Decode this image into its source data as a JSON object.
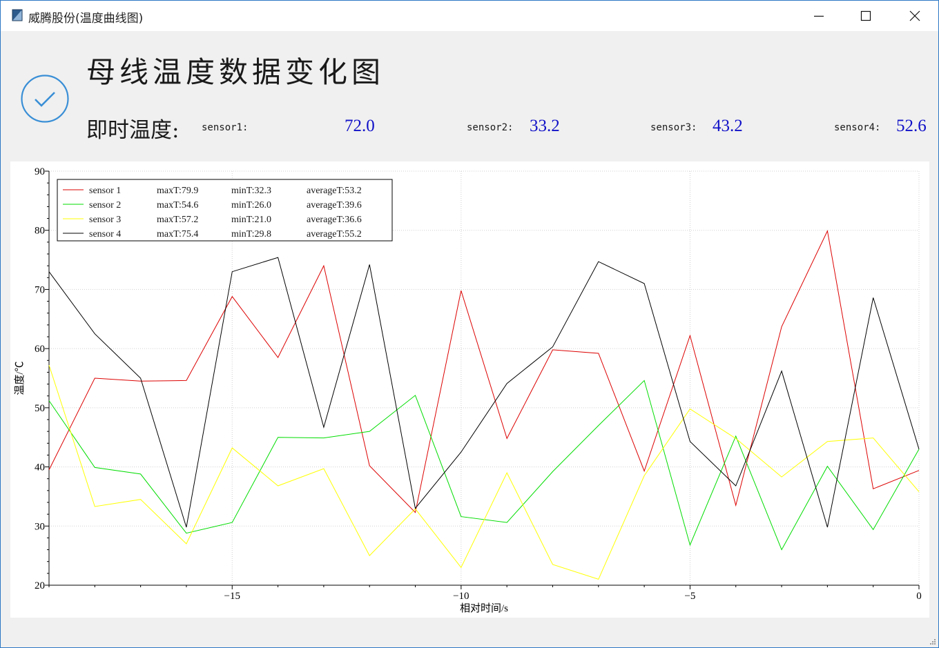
{
  "window": {
    "title": "威腾股份(温度曲线图)"
  },
  "header": {
    "title": "母线温度数据变化图",
    "live_label": "即时温度:",
    "sensors": [
      {
        "label": "sensor1:",
        "value": "72.0"
      },
      {
        "label": "sensor2:",
        "value": "33.2"
      },
      {
        "label": "sensor3:",
        "value": "43.2"
      },
      {
        "label": "sensor4:",
        "value": "52.6"
      }
    ],
    "icon": "check-circle-icon",
    "value_color": "#1010c8"
  },
  "chart_data": {
    "type": "line",
    "xlabel": "相对时间/s",
    "ylabel": "温度/℃",
    "xlim": [
      -19,
      0
    ],
    "ylim": [
      20,
      90
    ],
    "xticks": [
      -15,
      -10,
      -5,
      0
    ],
    "xtick_labels": [
      "−15",
      "−10",
      "−5",
      "0"
    ],
    "yticks": [
      20,
      30,
      40,
      50,
      60,
      70,
      80,
      90
    ],
    "grid": true,
    "legend_position": "top-left",
    "x": [
      -19,
      -18,
      -17,
      -16,
      -15,
      -14,
      -13,
      -12,
      -11,
      -10,
      -9,
      -8,
      -7,
      -6,
      -5,
      -4,
      -3,
      -2,
      -1,
      0
    ],
    "series": [
      {
        "name": "sensor 1",
        "color": "#dd0000",
        "stats": {
          "max": "maxT:79.9",
          "min": "minT:32.3",
          "avg": "averageT:53.2"
        },
        "values": [
          39.5,
          55.0,
          54.5,
          54.6,
          68.8,
          58.5,
          74.0,
          40.2,
          32.3,
          69.8,
          44.8,
          59.8,
          59.2,
          39.3,
          62.2,
          33.5,
          63.7,
          79.9,
          36.3,
          39.4
        ]
      },
      {
        "name": "sensor 2",
        "color": "#00dd00",
        "stats": {
          "max": "maxT:54.6",
          "min": "minT:26.0",
          "avg": "averageT:39.6"
        },
        "values": [
          51.2,
          39.9,
          38.8,
          28.8,
          30.6,
          45.0,
          44.9,
          46.0,
          52.1,
          31.6,
          30.6,
          39.2,
          47.0,
          54.6,
          26.8,
          45.2,
          26.0,
          40.1,
          29.4,
          43.0
        ]
      },
      {
        "name": "sensor 3",
        "color": "#ffff00",
        "stats": {
          "max": "maxT:57.2",
          "min": "minT:21.0",
          "avg": "averageT:36.6"
        },
        "values": [
          57.2,
          33.3,
          34.5,
          27.0,
          43.2,
          36.8,
          39.7,
          25.0,
          32.9,
          23.0,
          39.0,
          23.5,
          21.0,
          38.5,
          49.8,
          44.8,
          38.3,
          44.3,
          44.9,
          35.8
        ]
      },
      {
        "name": "sensor 4",
        "color": "#000000",
        "stats": {
          "max": "maxT:75.4",
          "min": "minT:29.8",
          "avg": "averageT:55.2"
        },
        "values": [
          73.0,
          62.5,
          55.0,
          29.8,
          73.0,
          75.4,
          46.7,
          74.2,
          33.0,
          42.5,
          54.1,
          60.3,
          74.7,
          71.0,
          44.3,
          36.8,
          56.2,
          29.8,
          68.6,
          43.0
        ]
      }
    ]
  }
}
